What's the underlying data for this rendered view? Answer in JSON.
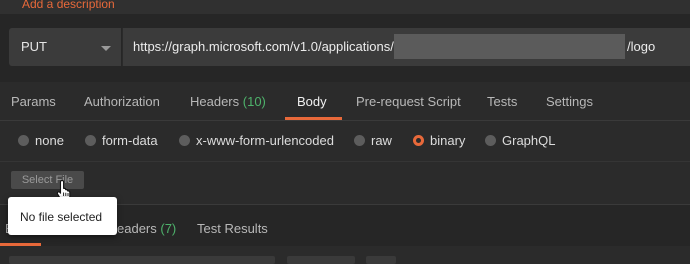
{
  "description": {
    "link_text": "Add a description"
  },
  "request": {
    "method": "PUT",
    "url_prefix": "https://graph.microsoft.com/v1.0/applications/",
    "url_suffix": "/logo"
  },
  "tabs": [
    {
      "label": "Params"
    },
    {
      "label": "Authorization"
    },
    {
      "label": "Headers",
      "count": "(10)"
    },
    {
      "label": "Body",
      "active": true
    },
    {
      "label": "Pre-request Script"
    },
    {
      "label": "Tests"
    },
    {
      "label": "Settings"
    }
  ],
  "body_options": [
    {
      "label": "none",
      "selected": false
    },
    {
      "label": "form-data",
      "selected": false
    },
    {
      "label": "x-www-form-urlencoded",
      "selected": false
    },
    {
      "label": "raw",
      "selected": false
    },
    {
      "label": "binary",
      "selected": true
    },
    {
      "label": "GraphQL",
      "selected": false
    }
  ],
  "file": {
    "button_label": "Select File",
    "tooltip": "No file selected"
  },
  "response_tabs": [
    {
      "label": "B"
    },
    {
      "label": "eaders",
      "count": "(7)"
    },
    {
      "label": "Test Results"
    }
  ],
  "colors": {
    "accent": "#e8693a",
    "count_green": "#4eb26b",
    "background": "#2b2b2b"
  },
  "icons": {
    "method_dropdown": "chevron-down-icon",
    "cursor": "hand-pointer-icon"
  }
}
